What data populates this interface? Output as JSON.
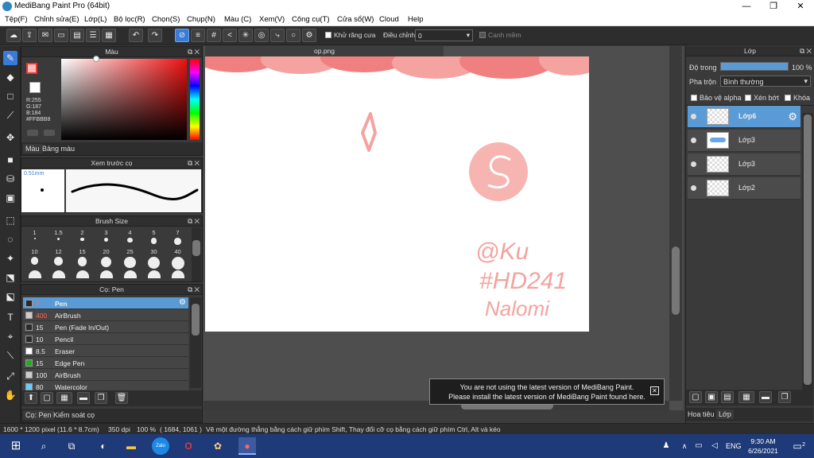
{
  "window": {
    "title": "MediBang Paint Pro (64bit)",
    "minimize": "—",
    "restore": "❐",
    "close": "✕"
  },
  "menu": [
    "Tệp(F)",
    "Chỉnh sửa(E)",
    "Lớp(L)",
    "Bộ lọc(R)",
    "Chọn(S)",
    "Chụp(N)",
    "Màu (C)",
    "Xem(V)",
    "Công cụ(T)",
    "Cửa sổ(W)",
    "Cloud",
    "Help"
  ],
  "toolbar": {
    "antialias_label": "Khử răng cưa",
    "correction_label": "Điều chỉnh",
    "correction_value": "0",
    "edge_label": "Canh mềm"
  },
  "color_panel": {
    "title": "Màu",
    "r": "R:255",
    "g": "G:187",
    "b": "B:184",
    "hex": "#FFBBB8",
    "tab_color": "Màu",
    "tab_palette": "Bảng màu",
    "fg_color": "#FFBBB8"
  },
  "brush_preview": {
    "title": "Xem trước cọ",
    "size": "0.51mm"
  },
  "brush_size": {
    "title": "Brush Size",
    "row1": [
      "1",
      "1.5",
      "2",
      "3",
      "4",
      "5",
      "7"
    ],
    "row2": [
      "10",
      "12",
      "15",
      "20",
      "25",
      "30",
      "40"
    ]
  },
  "brushes": {
    "title": "Cọ: Pen",
    "items": [
      {
        "size": "7",
        "name": "Pen",
        "color": "#2a2a2a"
      },
      {
        "size": "400",
        "name": "AirBrush",
        "color": "#cccccc"
      },
      {
        "size": "15",
        "name": "Pen (Fade In/Out)",
        "color": "#2a2a2a"
      },
      {
        "size": "10",
        "name": "Pencil",
        "color": "#2a2a2a"
      },
      {
        "size": "8.5",
        "name": "Eraser",
        "color": "#ffffff"
      },
      {
        "size": "15",
        "name": "Edge Pen",
        "color": "#22aa22"
      },
      {
        "size": "100",
        "name": "AirBrush",
        "color": "#cccccc"
      },
      {
        "size": "80",
        "name": "Watercolor",
        "color": "#66ccff"
      }
    ],
    "tab_brush": "Cọ: Pen",
    "tab_control": "Kiểm soát cọ"
  },
  "canvas": {
    "tab": "op.png",
    "art_text_1": "@Ku",
    "art_text_2": "#HD241",
    "art_text_3": "Nalomi"
  },
  "notice": {
    "line1": "You are not using the latest version of MediBang Paint.",
    "line2": "Please install the latest version of MediBang Paint found here."
  },
  "layer_panel": {
    "title": "Lớp",
    "opacity_label": "Độ trong",
    "opacity_value": "100 %",
    "opacity": 1.0,
    "blend_label": "Pha trộn",
    "blend_value": "Bình thường",
    "protect_alpha": "Bảo vệ alpha",
    "clipping": "Xén bớt",
    "lock": "Khóa",
    "layers": [
      {
        "name": "Lớp6",
        "selected": true
      },
      {
        "name": "Lớp3",
        "selected": false
      },
      {
        "name": "Lớp3",
        "selected": false
      },
      {
        "name": "Lớp2",
        "selected": false
      }
    ],
    "tab_material": "Hoa tiêu",
    "tab_layer": "Lớp"
  },
  "status": {
    "dimensions": "1600 * 1200 pixel",
    "physical": "(11.6 * 8.7cm)",
    "dpi": "350 dpi",
    "zoom": "100 %",
    "coords": "( 1684, 1061 )",
    "hint": "Vẽ một đường thẳng bằng cách giữ phím Shift, Thay đổi cỡ cọ bằng cách giữ phím Ctrl, Alt và kéo"
  },
  "taskbar": {
    "lang": "ENG",
    "time": "9:30 AM",
    "date": "6/26/2021",
    "notif_count": "2",
    "zalo_label": "Zalo"
  }
}
